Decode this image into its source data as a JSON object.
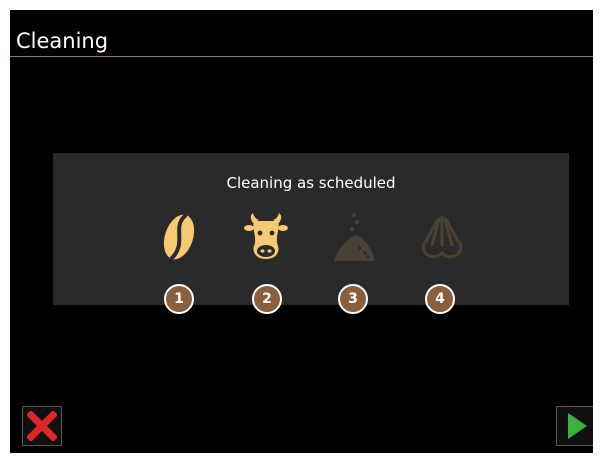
{
  "header": {
    "title": "Cleaning"
  },
  "panel": {
    "message": "Cleaning as scheduled",
    "steps": [
      {
        "number": "1",
        "icon": "coffee-bean-icon",
        "status": "active"
      },
      {
        "number": "2",
        "icon": "cow-icon",
        "status": "active"
      },
      {
        "number": "3",
        "icon": "powder-pile-icon",
        "status": "inactive"
      },
      {
        "number": "4",
        "icon": "rinse-spray-icon",
        "status": "inactive"
      }
    ]
  },
  "buttons": {
    "cancel": {
      "icon": "close-icon"
    },
    "start": {
      "icon": "play-icon"
    }
  },
  "colors": {
    "background": "#000000",
    "panel": "#2a2a2a",
    "icon_active": "#f6c973",
    "icon_inactive": "#4a4034",
    "badge": "#8b5e3c",
    "accent_line": "#9a7a55",
    "cancel": "#e0242b",
    "start": "#3cb13c"
  }
}
